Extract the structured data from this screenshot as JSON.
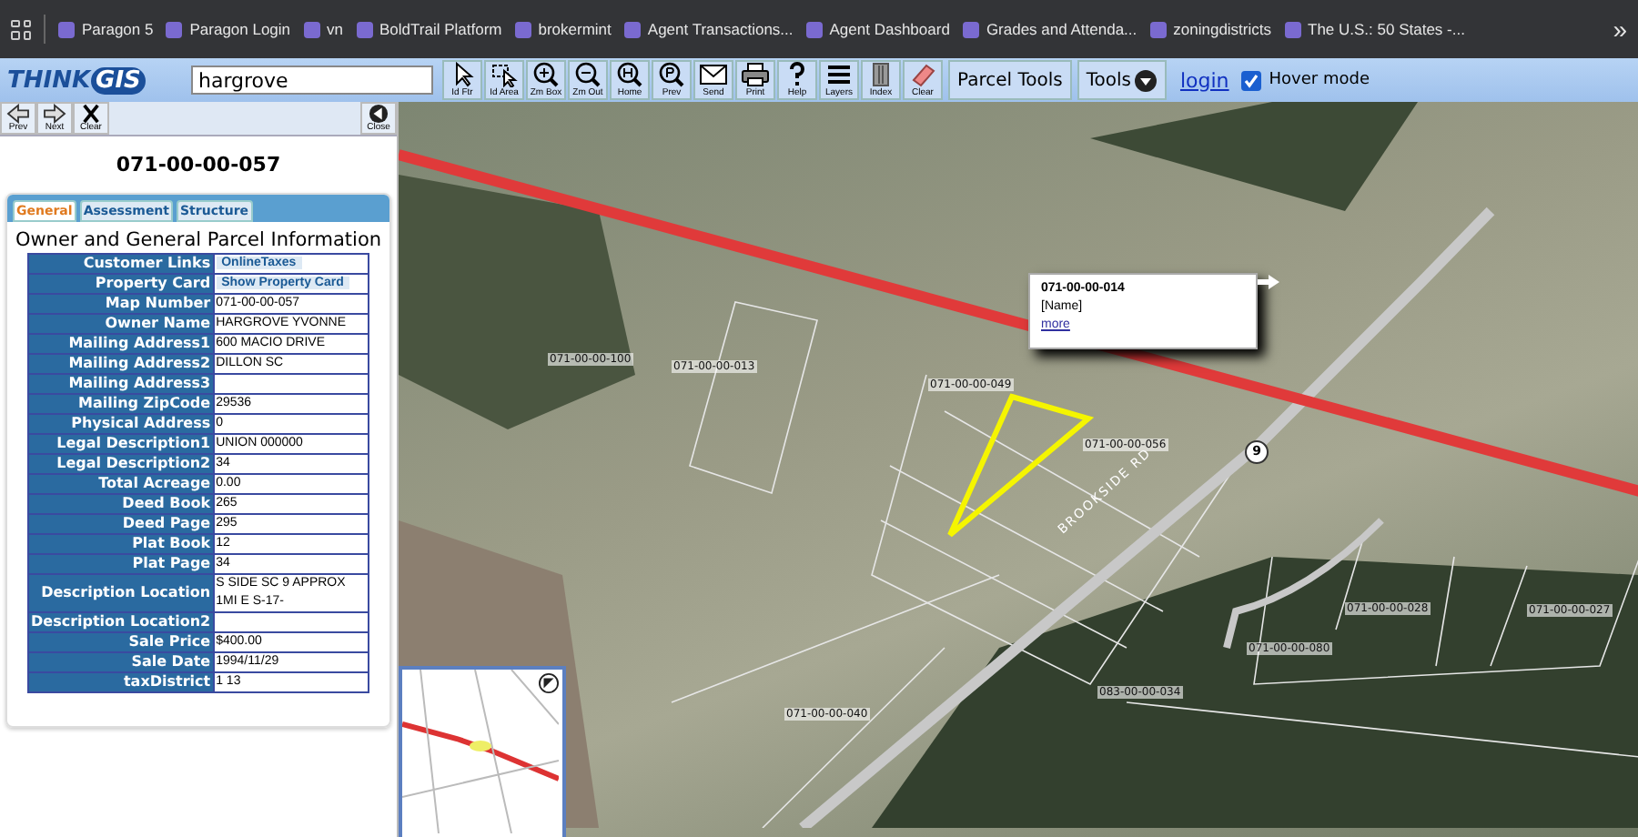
{
  "bookmarks": [
    {
      "label": "Paragon 5"
    },
    {
      "label": "Paragon Login"
    },
    {
      "label": "vn"
    },
    {
      "label": "BoldTrail Platform"
    },
    {
      "label": "brokermint"
    },
    {
      "label": "Agent Transactions..."
    },
    {
      "label": "Agent Dashboard"
    },
    {
      "label": "Grades and Attenda..."
    },
    {
      "label": "zoningdistricts"
    },
    {
      "label": "The U.S.: 50 States -..."
    }
  ],
  "overflow": "»",
  "toolbar": {
    "logo": "THINK",
    "logo_accent": "GIS",
    "search_value": "hargrove",
    "tools": [
      {
        "label": "Id Ftr",
        "kind": "pointer"
      },
      {
        "label": "Id Area",
        "kind": "area"
      },
      {
        "label": "Zm Box",
        "kind": "zoomin"
      },
      {
        "label": "Zm Out",
        "kind": "zoomout"
      },
      {
        "label": "Home",
        "kind": "home"
      },
      {
        "label": "Prev",
        "kind": "prev"
      },
      {
        "label": "Send",
        "kind": "mail"
      },
      {
        "label": "Print",
        "kind": "print"
      },
      {
        "label": "Help",
        "kind": "help"
      },
      {
        "label": "Layers",
        "kind": "layers"
      },
      {
        "label": "Index",
        "kind": "index"
      },
      {
        "label": "Clear",
        "kind": "eraser"
      }
    ],
    "parcel_tools": "Parcel Tools",
    "tools_menu": "Tools",
    "login": "login",
    "hover_mode": {
      "label": "Hover mode",
      "checked": true
    }
  },
  "panel": {
    "nav": [
      {
        "label": "Prev",
        "kind": "left"
      },
      {
        "label": "Next",
        "kind": "right"
      },
      {
        "label": "Clear",
        "kind": "x"
      }
    ],
    "close": "Close",
    "title": "071-00-00-057",
    "tabs": [
      {
        "label": "General",
        "selected": true
      },
      {
        "label": "Assessment",
        "selected": false
      },
      {
        "label": "Structure",
        "selected": false
      }
    ],
    "heading": "Owner and General Parcel Information",
    "rows": [
      {
        "label": "Customer Links",
        "value": "OnlineTaxes",
        "kind": "link"
      },
      {
        "label": "Property Card",
        "value": "Show Property Card",
        "kind": "link"
      },
      {
        "label": "Map Number",
        "value": "071-00-00-057",
        "kind": "text"
      },
      {
        "label": "Owner Name",
        "value": "HARGROVE YVONNE",
        "kind": "text"
      },
      {
        "label": "Mailing Address1",
        "value": "600 MACIO DRIVE",
        "kind": "text"
      },
      {
        "label": "Mailing Address2",
        "value": "DILLON SC",
        "kind": "text"
      },
      {
        "label": "Mailing Address3",
        "kind": "text"
      },
      {
        "label": "Mailing ZipCode",
        "value": "29536",
        "kind": "text"
      },
      {
        "label": "Physical Address",
        "value": "0",
        "kind": "text"
      },
      {
        "label": "Legal Description1",
        "value": "UNION 000000",
        "kind": "text"
      },
      {
        "label": "Legal Description2",
        "value": "34",
        "kind": "text"
      },
      {
        "label": "Total Acreage",
        "value": "0.00",
        "kind": "text"
      },
      {
        "label": "Deed Book",
        "value": "265",
        "kind": "text"
      },
      {
        "label": "Deed Page",
        "value": "295",
        "kind": "text"
      },
      {
        "label": "Plat Book",
        "value": "12",
        "kind": "text"
      },
      {
        "label": "Plat Page",
        "value": "34",
        "kind": "text"
      },
      {
        "label": "Description Location",
        "value": "S SIDE SC 9 APPROX 1MI E S-17-",
        "kind": "text"
      },
      {
        "label": "Description Location2",
        "kind": "text"
      },
      {
        "label": "Sale Price",
        "value": "$400.00",
        "kind": "text"
      },
      {
        "label": "Sale Date",
        "value": "1994/11/29",
        "kind": "text"
      },
      {
        "label": "taxDistrict",
        "value": "1 13",
        "kind": "text"
      }
    ]
  },
  "map": {
    "parcels": [
      {
        "label": "071-00-00-100"
      },
      {
        "label": "071-00-00-013"
      },
      {
        "label": "071-00-00-049"
      },
      {
        "label": "071-00-00-056"
      },
      {
        "label": "071-00-00-028"
      },
      {
        "label": "071-00-00-027"
      },
      {
        "label": "071-00-00-080"
      },
      {
        "label": "083-00-00-034"
      },
      {
        "label": "071-00-00-040"
      }
    ],
    "road_label": "BROOKSIDE RD",
    "route_marker": "9",
    "popup": {
      "title": "071-00-00-014",
      "name": "[Name]",
      "link": "more"
    }
  }
}
